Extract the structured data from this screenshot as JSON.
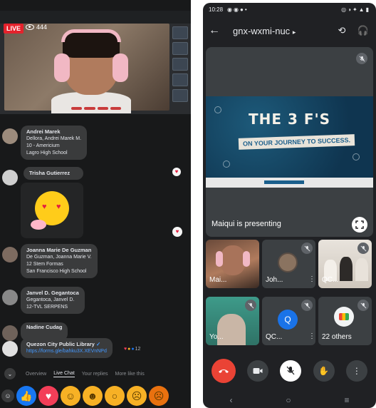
{
  "livestream": {
    "live_badge": "LIVE",
    "viewer_count": "444"
  },
  "chat": {
    "messages": [
      {
        "name": "Andrei Marek",
        "lines": [
          "Dellora, Andrei Marek M.",
          "10 - Americium",
          "Lagro High School"
        ]
      },
      {
        "name": "Trisha Gutierrez",
        "lines": []
      },
      {
        "name": "Joanna Marie De Guzman",
        "lines": [
          "De Guzman, Joanna Marie V.",
          "12 Stem Formas",
          "San Francisco High School"
        ]
      },
      {
        "name": "Janvel D. Gegantoca",
        "lines": [
          "Gegantoca, Janvel D.",
          "12-TVL SERPENS"
        ]
      },
      {
        "name": "Nadine Cudag",
        "lines": []
      },
      {
        "name": "Quezon City Public Library",
        "lines": [
          "https://forms.gle/bahku3X.XEVnNPd"
        ]
      }
    ],
    "link_reaction_count": "12"
  },
  "tabs": {
    "overview": "Overview",
    "live_chat": "Live Chat",
    "your_replies": "Your replies",
    "more_like_this": "More like this"
  },
  "meet": {
    "status_time": "10:28",
    "meeting_code": "gnx-wxmi-nuc",
    "slide_title": "THE 3 F'S",
    "slide_subtitle": "ON YOUR JOURNEY TO SUCCESS.",
    "presenting_label": "Maiqui is presenting",
    "tiles": [
      {
        "name": "Mai...",
        "avatar": ""
      },
      {
        "name": "Joh...",
        "avatar": ""
      },
      {
        "name": "QC...",
        "avatar": ""
      },
      {
        "name": "Yo...",
        "avatar": ""
      },
      {
        "name": "QC...",
        "avatar": "Q"
      },
      {
        "name": "22 others",
        "avatar": ""
      }
    ]
  },
  "colors": {
    "end_call": "#ea4335",
    "live_red": "#e4222c",
    "like_blue": "#1877f2",
    "meet_bg": "#202124"
  }
}
